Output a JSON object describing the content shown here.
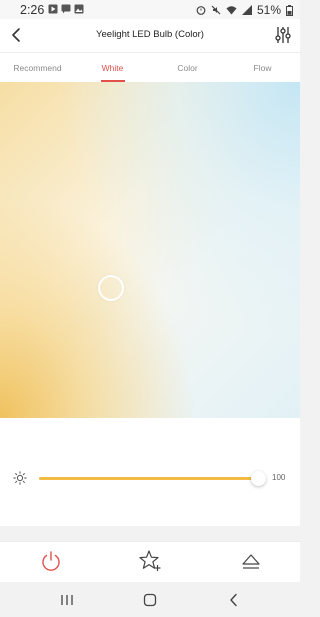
{
  "status_bar": {
    "time": "2:26",
    "battery": "51%"
  },
  "header": {
    "title": "Yeelight LED Bulb (Color)"
  },
  "tabs": [
    {
      "label": "Recommend",
      "active": false
    },
    {
      "label": "White",
      "active": true
    },
    {
      "label": "Color",
      "active": false
    },
    {
      "label": "Flow",
      "active": false
    }
  ],
  "brightness": {
    "value": "100",
    "level_percent": 100
  },
  "colors": {
    "accent": "#e2504c",
    "slider": "#f4bb43",
    "warm": "#f0c25f",
    "cool": "#c4e6f5"
  },
  "icons": {
    "back": "chevron-left-icon",
    "settings": "sliders-icon",
    "brightness": "sun-icon",
    "power": "power-icon",
    "favorite": "star-plus-icon",
    "eject": "eject-icon",
    "recents": "recents-icon",
    "home": "home-icon",
    "nav_back": "back-icon"
  }
}
